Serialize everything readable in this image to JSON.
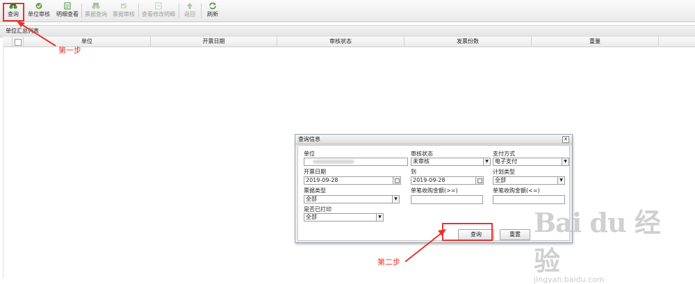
{
  "toolbar": {
    "buttons": [
      {
        "label": "查询",
        "enabled": true
      },
      {
        "label": "单位审核",
        "enabled": true
      },
      {
        "label": "明细查看",
        "enabled": true
      },
      {
        "label": "票据查询",
        "enabled": false
      },
      {
        "label": "票据审核",
        "enabled": false
      },
      {
        "label": "查看修改明细",
        "enabled": false
      },
      {
        "label": "返回",
        "enabled": false
      },
      {
        "label": "刷新",
        "enabled": true
      }
    ]
  },
  "panel": {
    "title": "单位汇总列表"
  },
  "grid": {
    "columns": [
      "单位",
      "开票日期",
      "审核状态",
      "发票份数",
      "重量"
    ]
  },
  "dialog": {
    "title": "查询信息",
    "close": "x",
    "fields": {
      "unit": {
        "label": "单位",
        "value": ""
      },
      "audit_status": {
        "label": "审核状态",
        "value": "未审核"
      },
      "payment": {
        "label": "支付方式",
        "value": "电子支付"
      },
      "invoice_date": {
        "label": "开票日期",
        "value": "2019-09-28"
      },
      "to": {
        "label": "到",
        "value": "2019-09-28"
      },
      "plan_type": {
        "label": "计划类型",
        "value": "全部"
      },
      "ticket_type": {
        "label": "票据类型",
        "value": "全部"
      },
      "min_amount": {
        "label": "单笔收购金额(>=)",
        "value": ""
      },
      "max_amount": {
        "label": "单笔收购金额(<=)",
        "value": ""
      },
      "printed": {
        "label": "是否已打印",
        "value": "全部"
      }
    },
    "buttons": {
      "query": "查询",
      "reset": "重置"
    }
  },
  "annotations": {
    "step1": "第一步",
    "step2": "第二步",
    "color": "#e8322a"
  },
  "watermark": {
    "brand": "Bai du 经验",
    "url": "jingyan.baidu.com"
  }
}
